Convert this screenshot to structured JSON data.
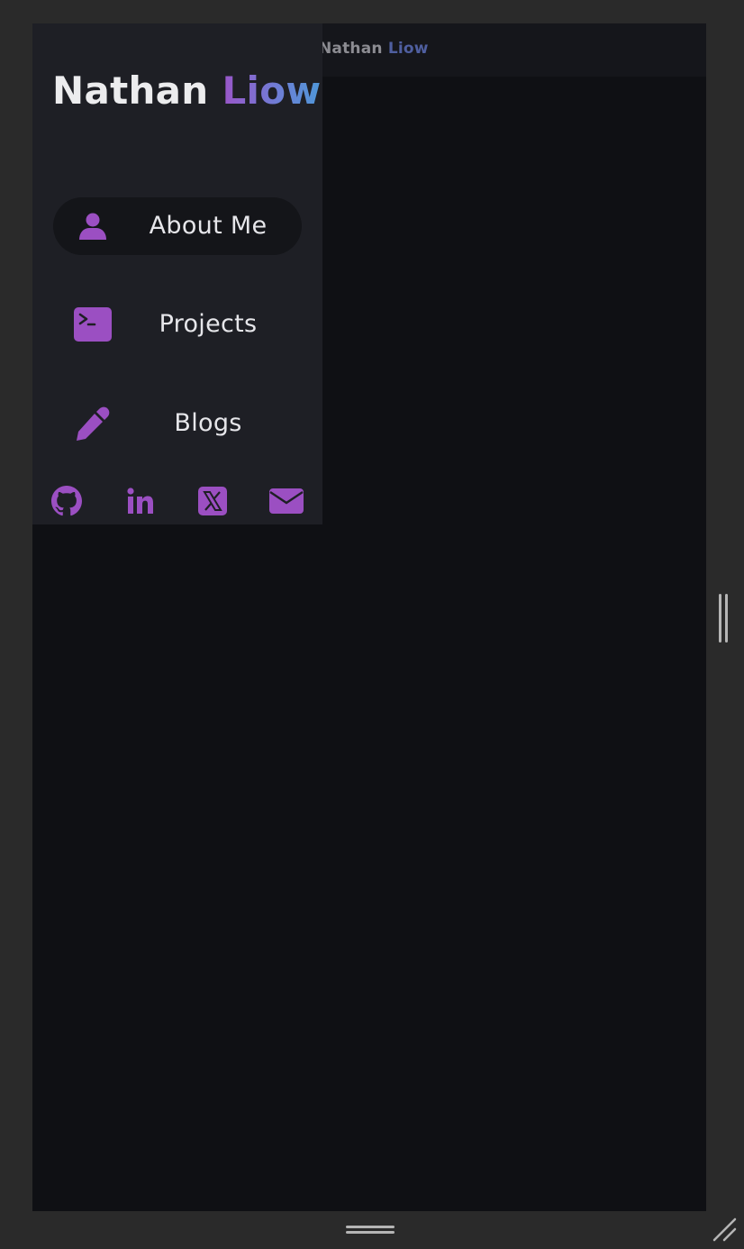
{
  "header": {
    "title_first": "Nathan",
    "title_last": "Liow"
  },
  "drawer": {
    "brand_first": "Nathan",
    "brand_last": "Liow",
    "nav": [
      {
        "label": "About Me",
        "icon": "user-icon",
        "active": true
      },
      {
        "label": "Projects",
        "icon": "terminal-icon",
        "active": false
      },
      {
        "label": "Blogs",
        "icon": "pencil-icon",
        "active": false
      }
    ],
    "socials": [
      {
        "icon": "github-icon"
      },
      {
        "icon": "linkedin-icon"
      },
      {
        "icon": "x-twitter-icon"
      },
      {
        "icon": "envelope-icon"
      }
    ]
  },
  "colors": {
    "accent": "#9b4fc2",
    "brand_gradient_start": "#9a55c8",
    "brand_gradient_end": "#4f97d8",
    "drawer_bg": "#1e1f25",
    "page_bg": "#0f1014",
    "active_item_bg": "#141519"
  }
}
